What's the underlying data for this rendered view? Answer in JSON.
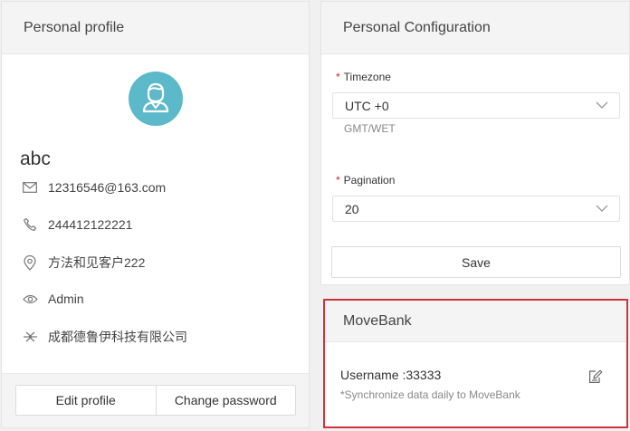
{
  "profile": {
    "title": "Personal profile",
    "username": "abc",
    "email": "12316546@163.com",
    "phone": "244412122221",
    "address": "方法和见客户222",
    "role": "Admin",
    "company": "成都德鲁伊科技有限公司",
    "edit_label": "Edit profile",
    "change_password_label": "Change password",
    "icons": [
      "avatar-icon",
      "mail-icon",
      "phone-icon",
      "location-icon",
      "eye-icon",
      "company-icon"
    ]
  },
  "config": {
    "title": "Personal Configuration",
    "timezone_label": "Timezone",
    "timezone_value": "UTC +0",
    "timezone_hint": "GMT/WET",
    "pagination_label": "Pagination",
    "pagination_value": "20",
    "required_mark": "*",
    "save_label": "Save"
  },
  "movebank": {
    "title": "MoveBank",
    "username_line": "Username :33333",
    "note": "*Synchronize data daily to MoveBank",
    "highlight_color": "#d0343a"
  },
  "colors": {
    "avatar_bg": "#5bb9c9",
    "required": "#e02020"
  }
}
